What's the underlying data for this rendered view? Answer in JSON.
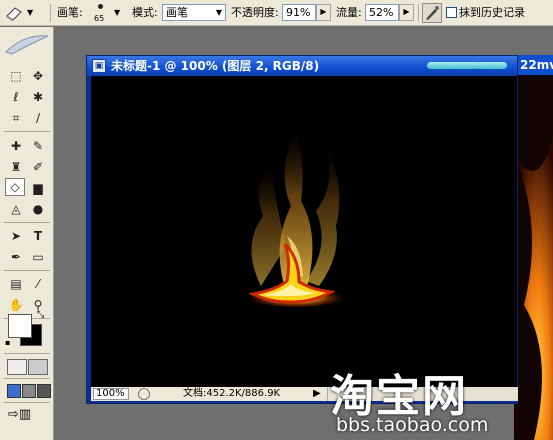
{
  "options": {
    "brush_label": "画笔:",
    "brush_size": "65",
    "mode_label": "模式:",
    "mode_value": "画笔",
    "opacity_label": "不透明度:",
    "opacity_value": "91%",
    "flow_label": "流量:",
    "flow_value": "52%",
    "history_label": "抹到历史记录"
  },
  "document": {
    "title": "未标题-1 @ 100% (图层 2, RGB/8)",
    "zoom": "100%",
    "doc_info": "文档:452.2K/886.9K"
  },
  "bg_window": {
    "title": "22mv"
  },
  "watermark": {
    "logo": "淘宝网",
    "url": "bbs.taobao.com"
  },
  "colors": {
    "titlebar": "#0f4fd0",
    "canvas": "#000000",
    "flame_core": "#ffd21a",
    "flame_outer": "#d02a00"
  }
}
